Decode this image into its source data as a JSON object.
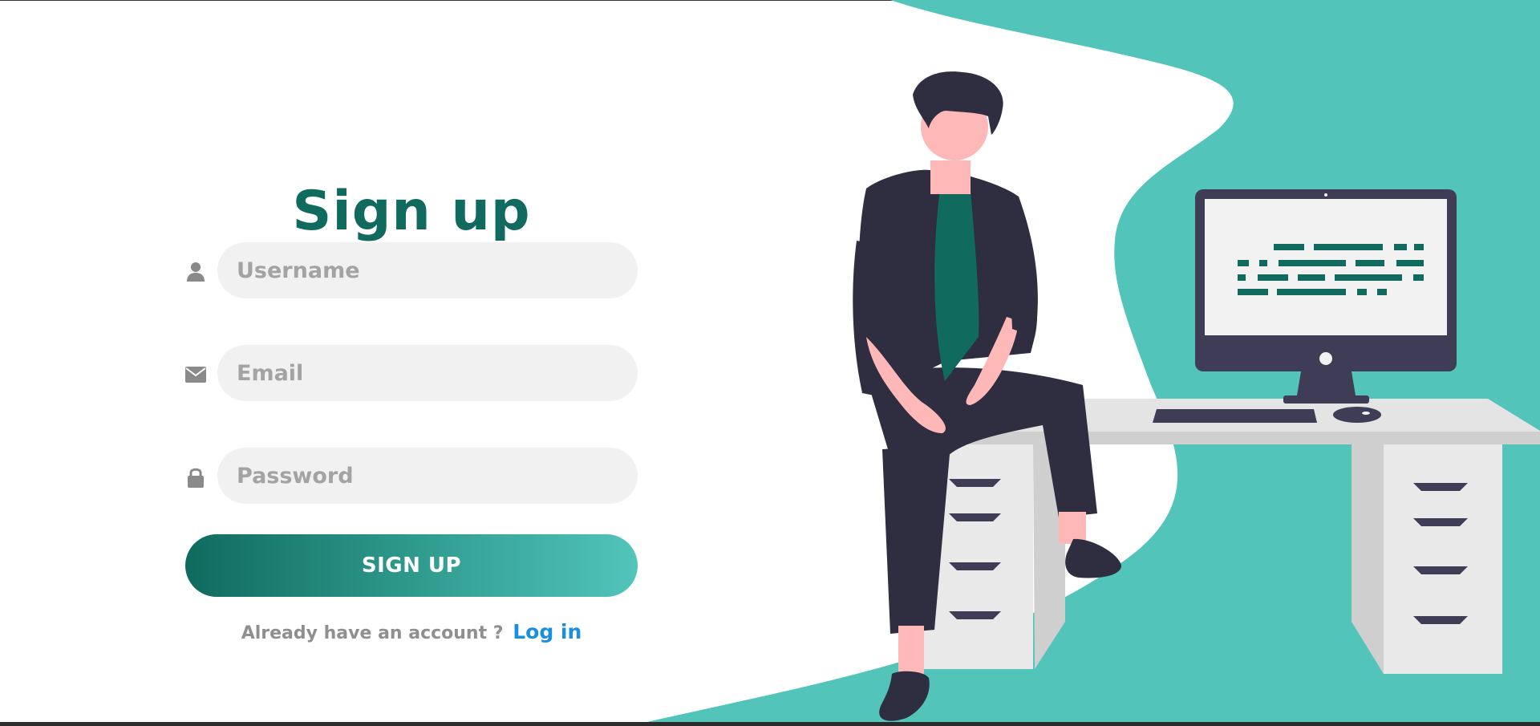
{
  "signup_form": {
    "title": "Sign up",
    "username": {
      "placeholder": "Username",
      "value": ""
    },
    "email": {
      "placeholder": "Email",
      "value": ""
    },
    "password": {
      "placeholder": "Password",
      "value": ""
    },
    "submit_label": "SIGN UP",
    "login_prompt": "Already have an account ?",
    "login_link": "Log in"
  },
  "icons": {
    "username": "user-icon",
    "email": "envelope-icon",
    "password": "lock-icon"
  },
  "colors": {
    "title": "#106a5e",
    "accent_teal": "#52c4ba",
    "button_gradient_start": "#106a5e",
    "button_gradient_end": "#52c4ba",
    "input_background": "#f1f1f1",
    "placeholder": "#a3a3a3",
    "link": "#1a8fe0",
    "prompt": "#8f8f8f",
    "icon": "#8a8a8a"
  }
}
